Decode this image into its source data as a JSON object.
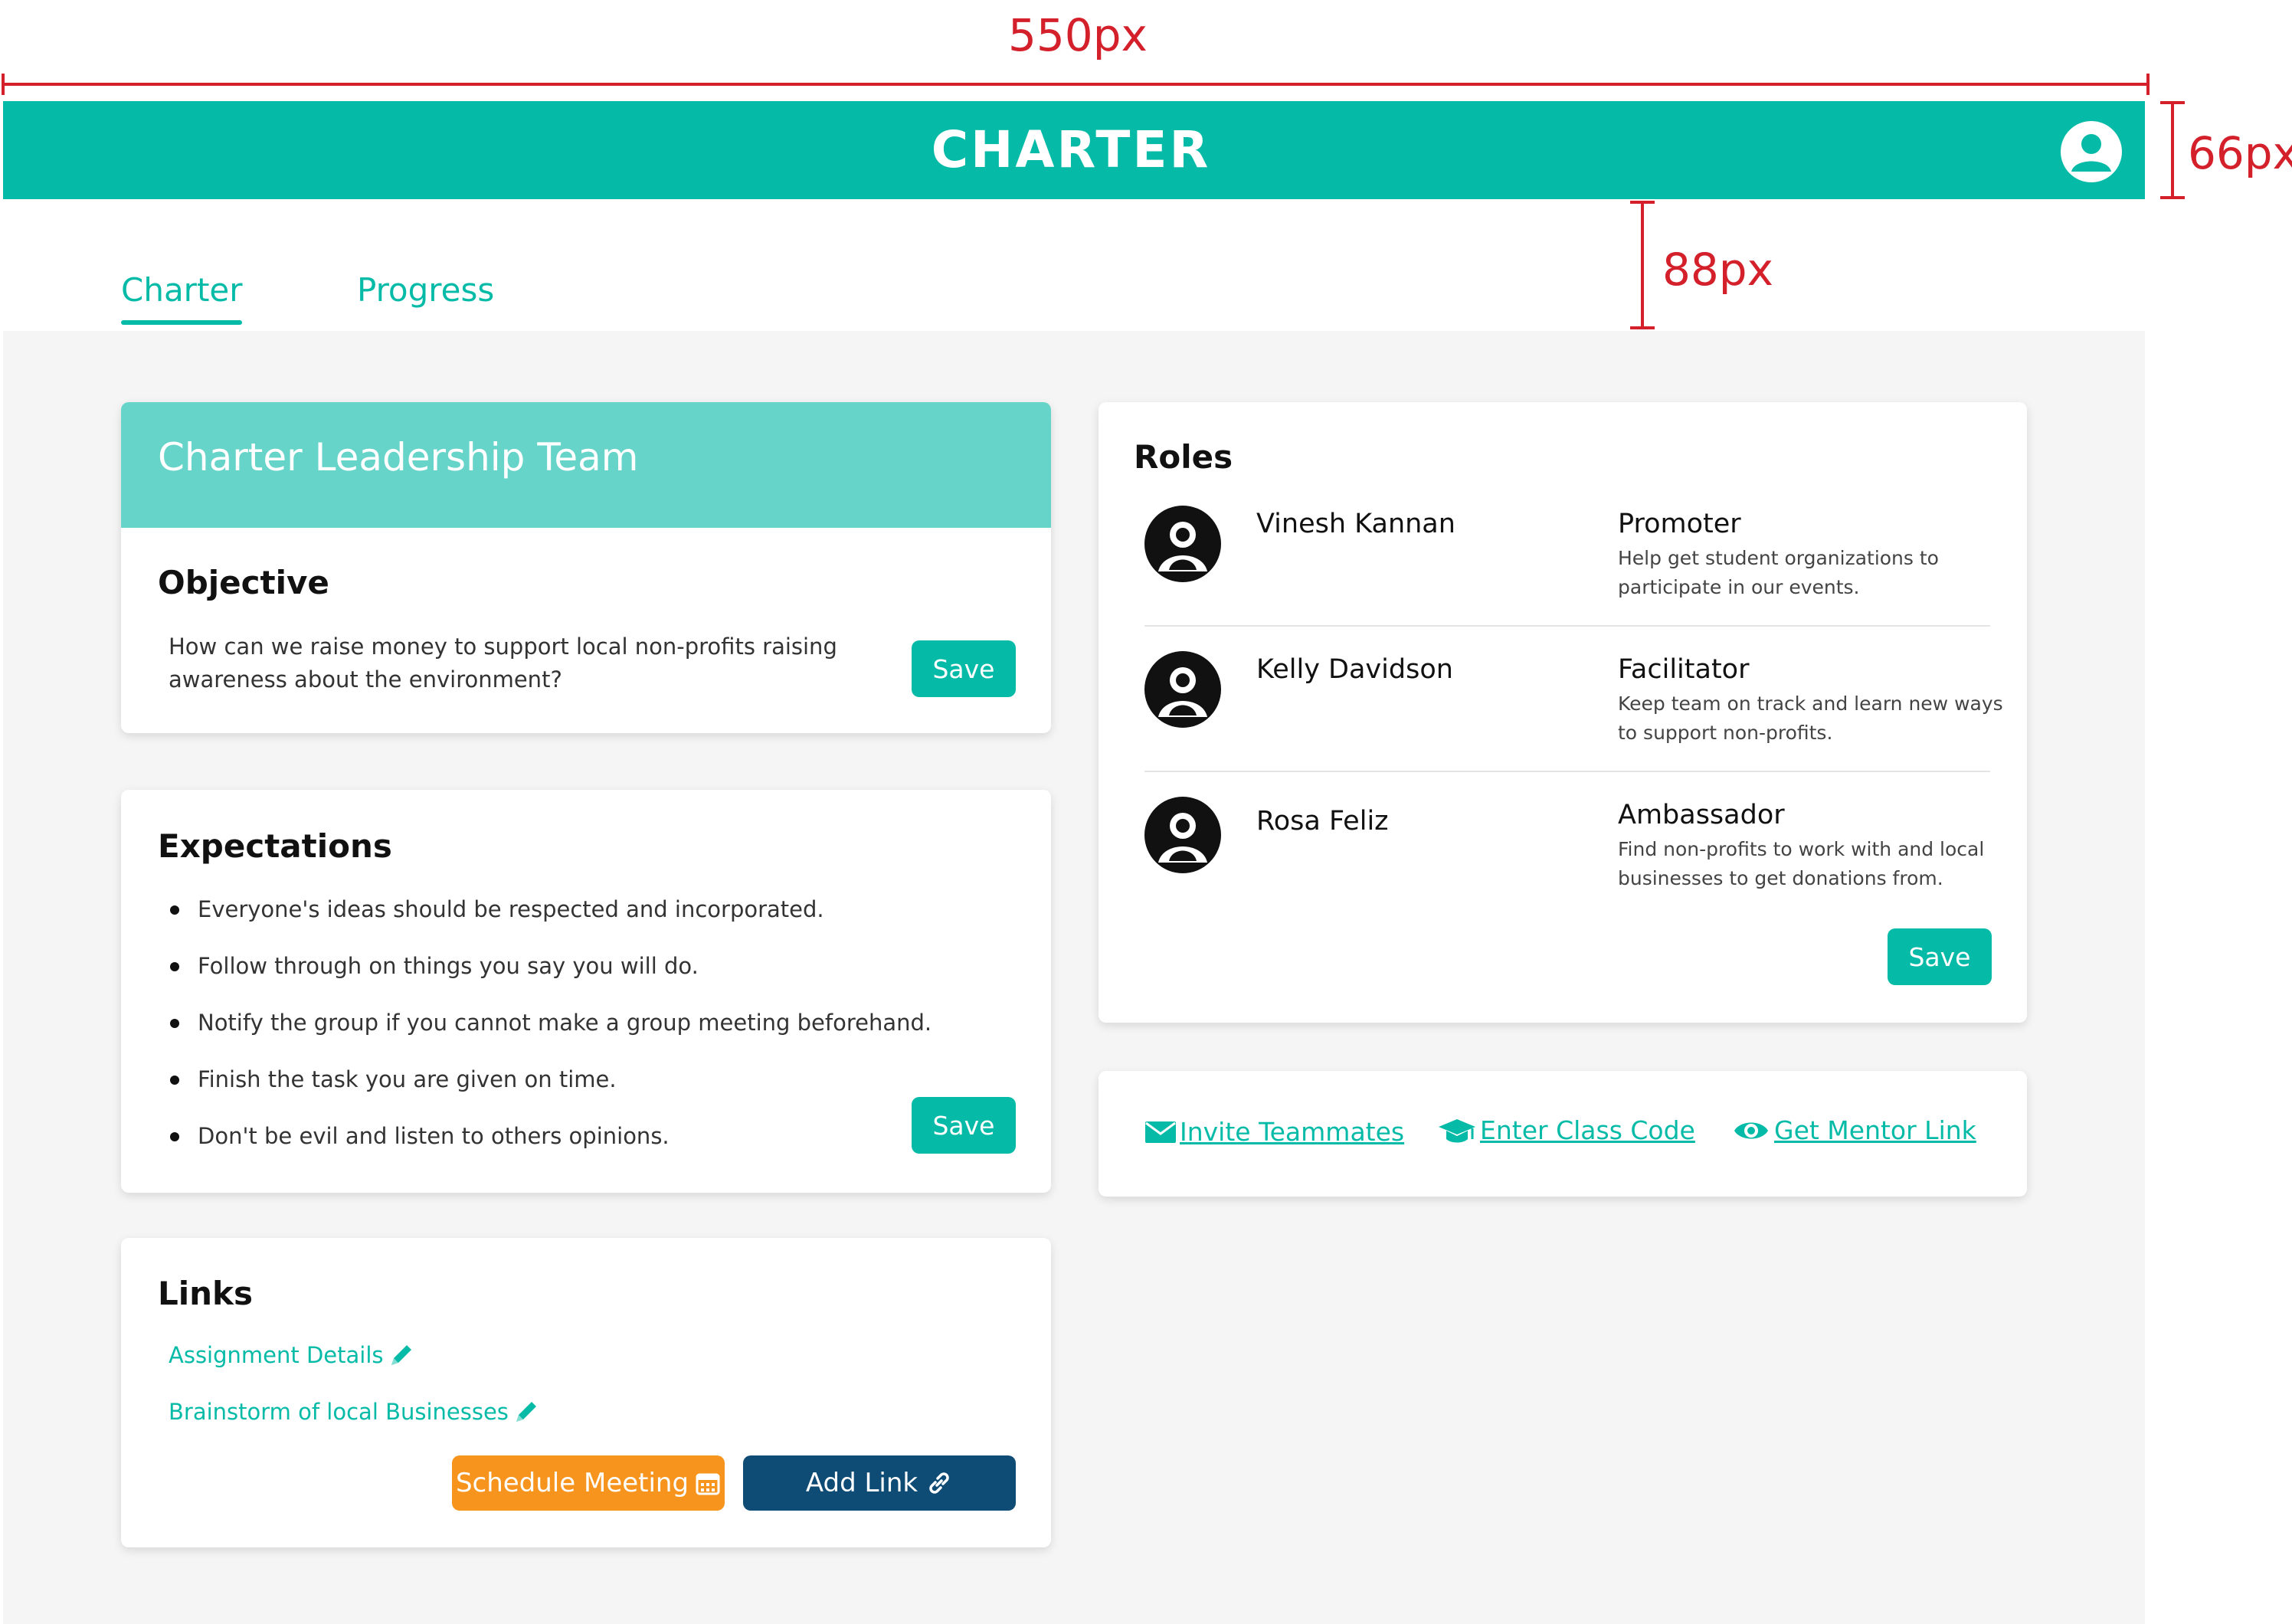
{
  "annotations": {
    "width_label": "550px",
    "height_label": "66px",
    "gap_label": "88px"
  },
  "header": {
    "logo": "CHARTER",
    "brand_color": "#05bba7"
  },
  "tabs": [
    {
      "label": "Charter",
      "active": true
    },
    {
      "label": "Progress",
      "active": false
    }
  ],
  "leadership": {
    "title": "Charter Leadership Team"
  },
  "objective": {
    "heading": "Objective",
    "text_line1": "How can we raise money to support local non-profits raising",
    "text_line2": "awareness about the environment?",
    "save_label": "Save"
  },
  "expectations": {
    "heading": "Expectations",
    "items": [
      "Everyone's ideas should be respected and incorporated.",
      "Follow through on things you say you will do.",
      "Notify the group if you cannot make a group meeting beforehand.",
      "Finish the task you are given on time.",
      "Don't be evil and listen to others opinions."
    ],
    "save_label": "Save"
  },
  "links": {
    "heading": "Links",
    "items": [
      "Assignment Details",
      "Brainstorm of local Businesses"
    ],
    "schedule_label": "Schedule Meeting",
    "add_link_label": "Add Link",
    "schedule_color": "#f7941d",
    "add_link_color": "#0f4c75"
  },
  "roles": {
    "heading": "Roles",
    "members": [
      {
        "name": "Vinesh Kannan",
        "role": "Promoter",
        "desc_line1": "Help get student organizations to",
        "desc_line2": "participate in our events."
      },
      {
        "name": "Kelly Davidson",
        "role": "Facilitator",
        "desc_line1": "Keep team on track and learn new ways",
        "desc_line2": "to support non-profits."
      },
      {
        "name": "Rosa Feliz",
        "role": "Ambassador",
        "desc_line1": "Find non-profits to work with and local",
        "desc_line2": "businesses to get donations from."
      }
    ],
    "save_label": "Save"
  },
  "actions": {
    "invite": "Invite Teammates",
    "class_code": "Enter Class Code",
    "mentor_link": "Get Mentor Link"
  }
}
